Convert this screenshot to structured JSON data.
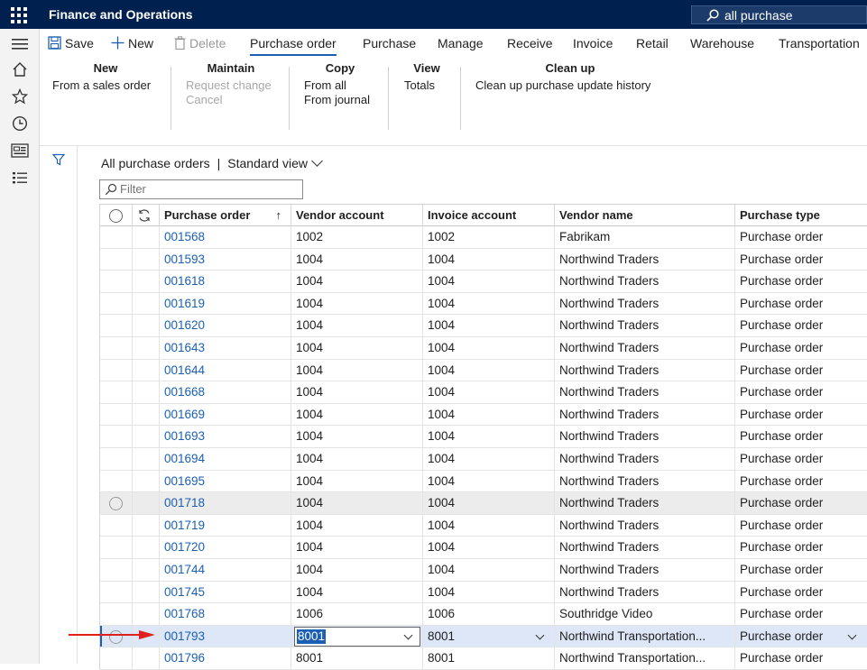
{
  "app": {
    "title": "Finance and Operations",
    "search_value": "all purchase"
  },
  "actions": {
    "save": "Save",
    "new": "New",
    "delete": "Delete",
    "tabs": [
      "Purchase order",
      "Purchase",
      "Manage",
      "Receive",
      "Invoice",
      "Retail",
      "Warehouse",
      "Transportation"
    ],
    "active_tab": "Purchase order"
  },
  "ribbon": {
    "groups": [
      {
        "title": "New",
        "items": [
          "From a sales order"
        ],
        "disabled": [
          false
        ]
      },
      {
        "title": "Maintain",
        "items": [
          "Request change",
          "Cancel"
        ],
        "disabled": [
          true,
          true
        ]
      },
      {
        "title": "Copy",
        "items": [
          "From all",
          "From journal"
        ],
        "disabled": [
          false,
          false
        ]
      },
      {
        "title": "View",
        "items": [
          "Totals"
        ],
        "disabled": [
          false
        ]
      },
      {
        "title": "Clean up",
        "items": [
          "Clean up purchase update history"
        ],
        "disabled": [
          false
        ]
      }
    ]
  },
  "view": {
    "title": "All purchase orders",
    "divider": "|",
    "view_name": "Standard view",
    "filter_placeholder": "Filter"
  },
  "grid": {
    "columns": [
      "Purchase order",
      "Vendor account",
      "Invoice account",
      "Vendor name",
      "Purchase type"
    ],
    "rows": [
      [
        "001568",
        "1002",
        "1002",
        "Fabrikam",
        "Purchase order"
      ],
      [
        "001593",
        "1004",
        "1004",
        "Northwind Traders",
        "Purchase order"
      ],
      [
        "001618",
        "1004",
        "1004",
        "Northwind Traders",
        "Purchase order"
      ],
      [
        "001619",
        "1004",
        "1004",
        "Northwind Traders",
        "Purchase order"
      ],
      [
        "001620",
        "1004",
        "1004",
        "Northwind Traders",
        "Purchase order"
      ],
      [
        "001643",
        "1004",
        "1004",
        "Northwind Traders",
        "Purchase order"
      ],
      [
        "001644",
        "1004",
        "1004",
        "Northwind Traders",
        "Purchase order"
      ],
      [
        "001668",
        "1004",
        "1004",
        "Northwind Traders",
        "Purchase order"
      ],
      [
        "001669",
        "1004",
        "1004",
        "Northwind Traders",
        "Purchase order"
      ],
      [
        "001693",
        "1004",
        "1004",
        "Northwind Traders",
        "Purchase order"
      ],
      [
        "001694",
        "1004",
        "1004",
        "Northwind Traders",
        "Purchase order"
      ],
      [
        "001695",
        "1004",
        "1004",
        "Northwind Traders",
        "Purchase order"
      ],
      [
        "001718",
        "1004",
        "1004",
        "Northwind Traders",
        "Purchase order"
      ],
      [
        "001719",
        "1004",
        "1004",
        "Northwind Traders",
        "Purchase order"
      ],
      [
        "001720",
        "1004",
        "1004",
        "Northwind Traders",
        "Purchase order"
      ],
      [
        "001744",
        "1004",
        "1004",
        "Northwind Traders",
        "Purchase order"
      ],
      [
        "001745",
        "1004",
        "1004",
        "Northwind Traders",
        "Purchase order"
      ],
      [
        "001768",
        "1006",
        "1006",
        "Southridge Video",
        "Purchase order"
      ],
      [
        "001793",
        "8001",
        "8001",
        "Northwind Transportation...",
        "Purchase order"
      ],
      [
        "001796",
        "8001",
        "8001",
        "Northwind Transportation...",
        "Purchase order"
      ]
    ],
    "hover_row": 12,
    "selected_row": 18,
    "editing_value": "8001"
  },
  "colors": {
    "topbar": "#002050",
    "link": "#1a5fb4",
    "annotation_arrow": "#e02020"
  },
  "icons": [
    "waffle-icon",
    "search-icon",
    "hamburger-icon",
    "home-icon",
    "star-icon",
    "clock-icon",
    "workspace-icon",
    "list-icon",
    "save-icon",
    "plus-icon",
    "trash-icon",
    "funnel-icon",
    "refresh-icon"
  ]
}
